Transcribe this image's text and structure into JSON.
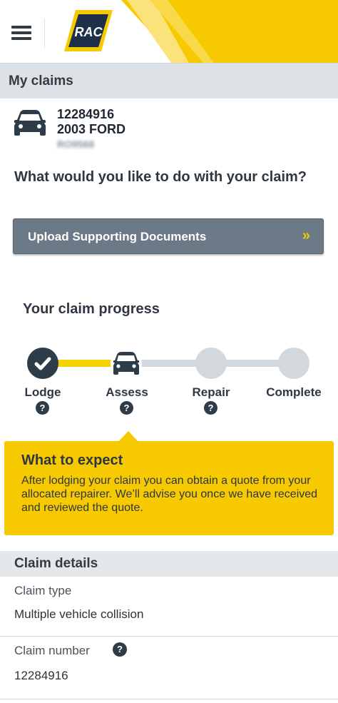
{
  "header": {
    "menu_icon": "hamburger-menu-icon",
    "logo_text": "RAC",
    "brand_yellow": "#f6c900",
    "brand_navy": "#1e2f4a"
  },
  "page": {
    "title": "My claims"
  },
  "vehicle": {
    "icon": "car-icon",
    "claim_id": "12284916",
    "description": "2003 FORD",
    "registration": "RO9568"
  },
  "actions": {
    "question": "What would you like to do with your claim?",
    "upload_label": "Upload Supporting Documents",
    "upload_chevron": "»"
  },
  "progress": {
    "title": "Your claim progress",
    "steps": [
      {
        "label": "Lodge",
        "status": "complete",
        "icon": "check-icon",
        "help": "?"
      },
      {
        "label": "Assess",
        "status": "current",
        "icon": "car-icon",
        "help": "?"
      },
      {
        "label": "Repair",
        "status": "pending",
        "help": "?"
      },
      {
        "label": "Complete",
        "status": "pending"
      }
    ]
  },
  "expect": {
    "title": "What to expect",
    "body": "After lodging your claim you can obtain a quote from your allocated repairer. We’ll advise you once we have received and reviewed the quote."
  },
  "details": {
    "title": "Claim details",
    "fields": [
      {
        "label": "Claim type",
        "value": "Multiple vehicle collision"
      },
      {
        "label": "Claim number",
        "value": "12284916",
        "help": "?"
      }
    ]
  }
}
